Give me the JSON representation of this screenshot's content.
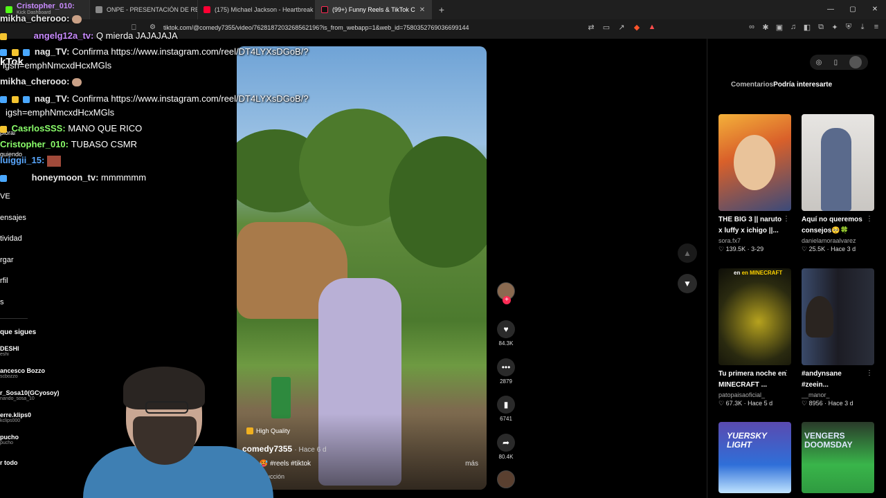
{
  "browser": {
    "tabs": [
      {
        "label": "Cristopher_010:",
        "sub": "Kick Dashboard",
        "active": false
      },
      {
        "label": "ONPE - PRESENTACIÓN DE RESULTA",
        "active": false
      },
      {
        "label": "(175) Michael Jackson - Heartbreak H",
        "active": false
      },
      {
        "label": "(99+) Funny Reels & TikTok C",
        "active": true
      }
    ],
    "url": "tiktok.com/@comedy7355/video/7628187203268562196?is_from_webapp=1&web_id=7580352769036699144",
    "window_controls": [
      "—",
      "▢",
      "✕"
    ]
  },
  "chat": {
    "lines": [
      {
        "user": "mikha_cherooo:",
        "msg": "",
        "color": "#e7e7e7"
      },
      {
        "user": "angelg12a_tv:",
        "msg": "Q mierda JAJAJAJA",
        "color": "#c98bff"
      },
      {
        "user": "nag_TV:",
        "msg": "Confirma https://www.instagram.com/reel/DT4LYXsDGoB/?",
        "color": "#e7e7e7"
      },
      {
        "user": "",
        "msg": "igsh=emphNmcxdHcxMGls",
        "color": "#fff"
      },
      {
        "user": "mikha_cherooo:",
        "msg": "",
        "color": "#e7e7e7"
      },
      {
        "user": "nag_TV:",
        "msg": "Confirma https://www.instagram.com/reel/DT4LYXsDGoB/?",
        "color": "#e7e7e7"
      },
      {
        "user": "",
        "msg": "igsh=emphNmcxdHcxMGls",
        "color": "#fff"
      },
      {
        "user": "CasrlosSSS:",
        "msg": "MANO QUE RICO",
        "color": "#8bff6b"
      },
      {
        "user": "Cristopher_010:",
        "msg": "TUBASO CSMR",
        "color": "#8bff6b"
      },
      {
        "user": "luiggii_15:",
        "msg": "",
        "color": "#5aa8ff"
      },
      {
        "user": "honeymoon_tv:",
        "msg": "mmmmmm",
        "color": "#e7e7e7"
      }
    ],
    "fragments": [
      "kTok",
      "plorar",
      "guiendo"
    ]
  },
  "sidebar": {
    "items": [
      "VE",
      "ensajes",
      "tividad",
      "rgar",
      "rfil",
      "s"
    ],
    "following_title": "que sigues",
    "following": [
      {
        "name": "DESHI",
        "handle": "eshi"
      },
      {
        "name": "ancesco Bozzo",
        "handle": "scbozzo"
      },
      {
        "name": "r_Sosa10(GCyosoy)",
        "handle": "nando_sosa_10"
      },
      {
        "name": "erre.klips0",
        "handle": "kclips000"
      },
      {
        "name": "pucho",
        "handle": "pucho"
      }
    ],
    "see_all": "r todo"
  },
  "video": {
    "quality": "High Quality",
    "author": "comedy7355",
    "ago": "· Hace 6 d",
    "caption": "nny 🥵 #reels #tiktok",
    "more": "más",
    "translate": "raducción"
  },
  "actions": {
    "likes": "84.3K",
    "comments": "2879",
    "saves": "6741",
    "shares": "80.4K"
  },
  "right_panel": {
    "tab_comments": "Comentarios",
    "tab_interesting": "Podría interesarte",
    "cards": [
      {
        "title": "THE BIG 3 || naruto x luffy x ichigo ||...",
        "user": "sora.fx7",
        "stats": "♡ 139.5K · 3-29"
      },
      {
        "title": "Aquí no queremos consejos🥺🍀",
        "user": "danielamoraalvarez",
        "stats": "♡ 25.5K · Hace 3 d"
      },
      {
        "title": "Tu primera noche en MINECRAFT ...",
        "user": "patopaisaoficial_",
        "stats": "♡ 67.3K · Hace 5 d",
        "overlay": "en MINECRAFT"
      },
      {
        "title": "#andynsane #zeein...",
        "user": "__manor_",
        "stats": "♡ 8956 · Hace 3 d"
      },
      {
        "title": "",
        "user": "",
        "stats": "",
        "overlay": "YUERSKY LIGHT"
      },
      {
        "title": "",
        "user": "",
        "stats": "",
        "overlay": "VENGERS DOOMSDAY"
      }
    ]
  },
  "colors": {
    "tiktok_red": "#fe2c55",
    "bg": "#000000"
  }
}
